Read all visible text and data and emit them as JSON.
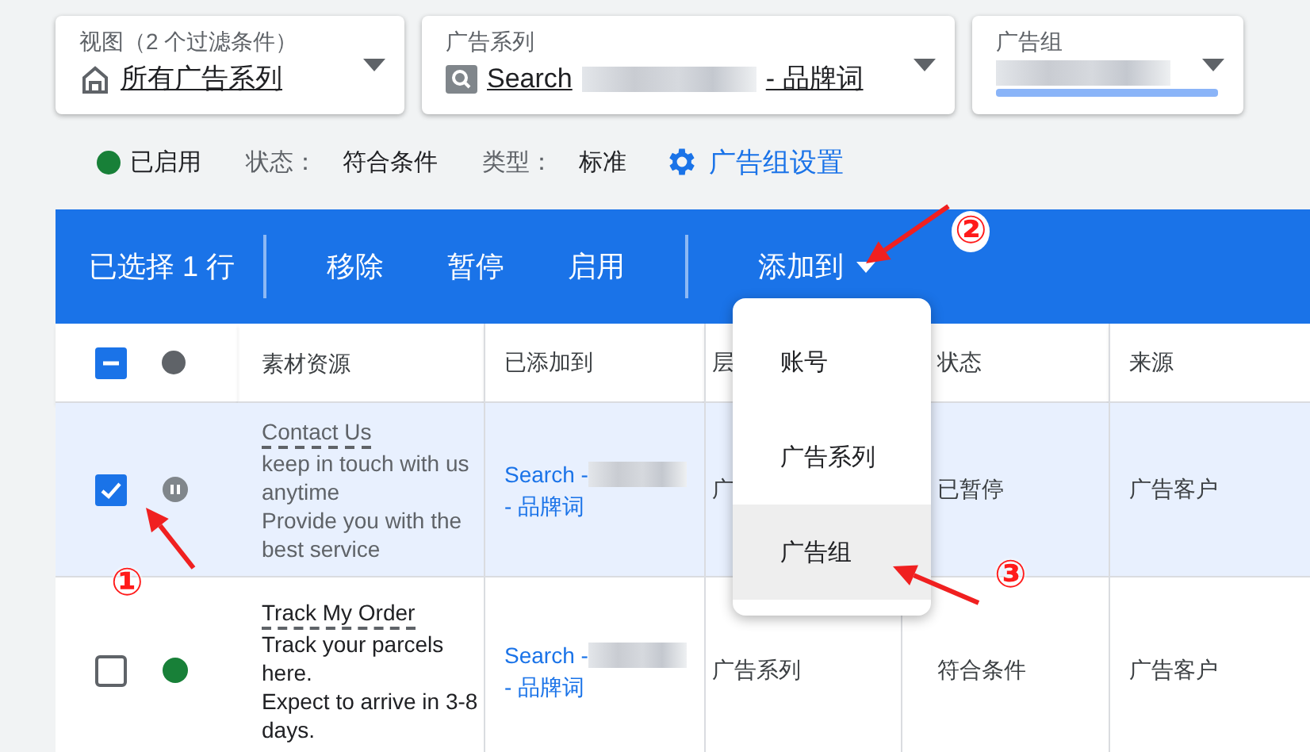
{
  "filters": [
    {
      "label": "视图（2 个过滤条件）",
      "kind": "view",
      "parts": [
        {
          "kind": "text",
          "text": "所有广告系列"
        }
      ]
    },
    {
      "label": "广告系列",
      "kind": "campaign",
      "parts": [
        {
          "kind": "text",
          "text": "Search"
        },
        {
          "kind": "redacted"
        },
        {
          "kind": "text",
          "text": "- 品牌词"
        }
      ]
    },
    {
      "label": "广告组",
      "kind": "ad_group",
      "parts": [
        {
          "kind": "redacted"
        }
      ]
    }
  ],
  "summary": {
    "items": [
      {
        "kind": "dot",
        "color": "#188038",
        "text": "已启用"
      },
      {
        "kind": "pair",
        "label": "状态：",
        "value": "符合条件"
      },
      {
        "kind": "pair",
        "label": "类型：",
        "value": "标准"
      }
    ],
    "link": "广告组设置"
  },
  "toolbar": {
    "selection": "已选择 1 行",
    "actions": [
      "移除",
      "暂停",
      "启用"
    ],
    "menu_button": "添加到"
  },
  "menu": {
    "items": [
      {
        "label": "账号",
        "selected": false
      },
      {
        "label": "广告系列",
        "selected": false
      },
      {
        "label": "广告组",
        "selected": true
      }
    ]
  },
  "table": {
    "header_partial": true,
    "columns": [
      "素材资源",
      "已添加到",
      "层",
      "状态",
      "来源"
    ],
    "rows": [
      {
        "selected": true,
        "checked": true,
        "paused": true,
        "title": "Contact Us",
        "description": [
          "keep in touch with us anytime",
          "Provide you with the best service"
        ],
        "added_to": [
          {
            "kind": "text",
            "text": "Search -"
          },
          {
            "kind": "redacted"
          },
          {
            "kind": "text",
            "text": "- 品牌词"
          }
        ],
        "level": "广",
        "status_text": "已暂停",
        "source": "广告客户"
      },
      {
        "selected": false,
        "checked": false,
        "paused": false,
        "title": "Track My Order",
        "description": [
          "Track your parcels here.",
          "Expect to arrive in 3-8 days."
        ],
        "added_to": [
          {
            "kind": "text",
            "text": "Search -"
          },
          {
            "kind": "redacted"
          },
          {
            "kind": "text",
            "text": "- 品牌词"
          }
        ],
        "level": "广告系列",
        "status_text": "符合条件",
        "source": "广告客户"
      }
    ]
  },
  "annotations": [
    {
      "mark": "①"
    },
    {
      "mark": "②"
    },
    {
      "mark": "③"
    }
  ]
}
